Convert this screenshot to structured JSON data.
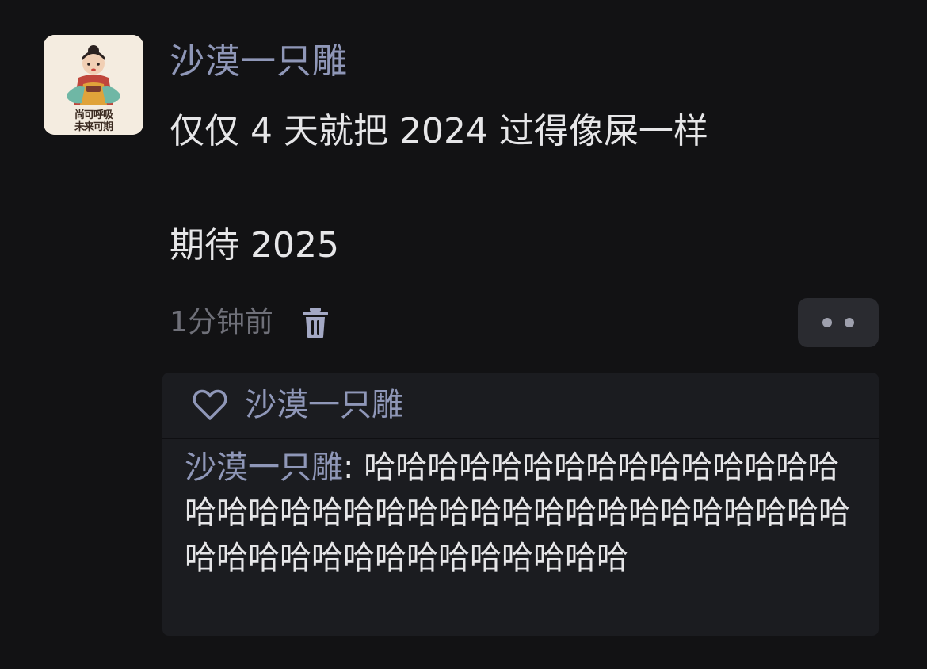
{
  "post": {
    "avatar_text_line1": "尚可呼吸",
    "avatar_text_line2": "未来可期",
    "username": "沙漠一只雕",
    "body_line1": "仅仅 4 天就把 2024 过得像屎一样",
    "body_line2": "期待 2025",
    "timestamp": "1分钟前",
    "icons": {
      "delete": "trash-icon",
      "more": "more-dots-icon"
    }
  },
  "reply_box": {
    "like_icon": "heart-icon",
    "liked_by": "沙漠一只雕",
    "comment": {
      "author": "沙漠一只雕",
      "separator": ": ",
      "text": "哈哈哈哈哈哈哈哈哈哈哈哈哈哈哈哈哈哈哈哈哈哈哈哈哈哈哈哈哈哈哈哈哈哈哈哈哈哈哈哈哈哈哈哈哈哈哈哈哈哈"
    }
  },
  "colors": {
    "background": "#121214",
    "username": "#8f97b8",
    "body_text": "#e6e6e8",
    "muted": "#6f7079",
    "reply_bg": "#1b1c20"
  }
}
